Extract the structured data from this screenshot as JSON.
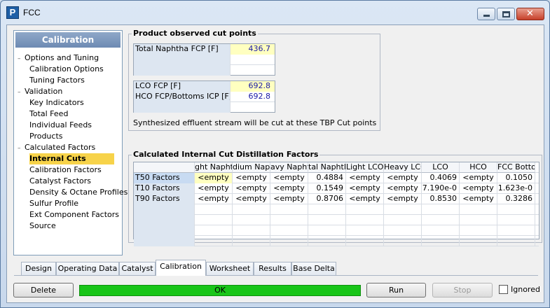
{
  "window": {
    "title": "FCC",
    "app_icon_letter": "P"
  },
  "nav": {
    "header": "Calibration",
    "items": [
      {
        "label": "Options and Tuning",
        "level": 0,
        "expanded": true
      },
      {
        "label": "Calibration Options",
        "level": 1
      },
      {
        "label": "Tuning Factors",
        "level": 1
      },
      {
        "label": "Validation",
        "level": 0,
        "expanded": true
      },
      {
        "label": "Key Indicators",
        "level": 1
      },
      {
        "label": "Total Feed",
        "level": 1
      },
      {
        "label": "Individual Feeds",
        "level": 1
      },
      {
        "label": "Products",
        "level": 1
      },
      {
        "label": "Calculated Factors",
        "level": 0,
        "expanded": true
      },
      {
        "label": "Internal Cuts",
        "level": 1,
        "selected": true
      },
      {
        "label": "Calibration Factors",
        "level": 1
      },
      {
        "label": "Catalyst Factors",
        "level": 1
      },
      {
        "label": "Density & Octane Profiles",
        "level": 1
      },
      {
        "label": "Sulfur Profile",
        "level": 1
      },
      {
        "label": "Ext Component Factors",
        "level": 1
      },
      {
        "label": "Source",
        "level": 1
      }
    ]
  },
  "cut_points": {
    "title": "Product observed cut points",
    "naphtha": {
      "label": "Total Naphtha FCP [F]",
      "value": "436.7"
    },
    "lco": {
      "label": "LCO FCP [F]",
      "value": "692.8"
    },
    "hco": {
      "label": "HCO FCP/Bottoms ICP [F]",
      "value": "692.8"
    },
    "note": "Synthesized effluent stream will be cut at these TBP Cut points"
  },
  "distillation": {
    "title": "Calculated Internal Cut Distillation Factors",
    "columns": [
      "ght Naphth",
      "dium Naph",
      "avy Naphtl",
      "tal Naphtl",
      "Light LCO",
      "Heavy LCO",
      "LCO",
      "HCO",
      "FCC Bottom"
    ],
    "rows": [
      {
        "label": "T50 Factors",
        "cells": [
          "<empty",
          "<empty",
          "<empty",
          "0.4884",
          "<empty",
          "<empty",
          "0.4069",
          "<empty",
          "0.1050"
        ]
      },
      {
        "label": "T10 Factors",
        "cells": [
          "<empty",
          "<empty",
          "<empty",
          "0.1549",
          "<empty",
          "<empty",
          "7.190e-0",
          "<empty",
          "1.623e-0"
        ]
      },
      {
        "label": "T90 Factors",
        "cells": [
          "<empty",
          "<empty",
          "<empty",
          "0.8706",
          "<empty",
          "<empty",
          "0.8530",
          "<empty",
          "0.3286"
        ]
      }
    ]
  },
  "tabs": [
    "Design",
    "Operating Data",
    "Catalyst",
    "Calibration",
    "Worksheet",
    "Results",
    "Base Delta"
  ],
  "active_tab": "Calibration",
  "buttons": {
    "delete": "Delete",
    "run": "Run",
    "stop": "Stop",
    "ignored": "Ignored"
  },
  "status": {
    "text": "OK",
    "color": "#18c518"
  }
}
